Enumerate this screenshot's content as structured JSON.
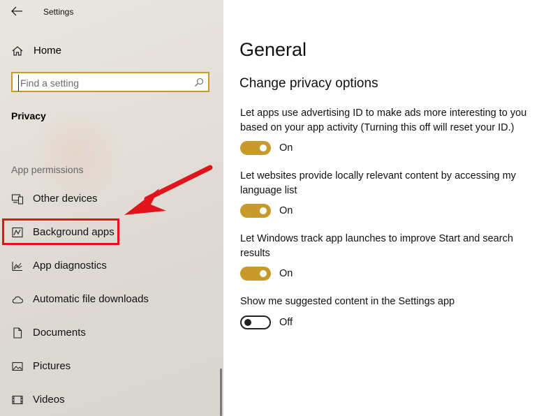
{
  "window": {
    "title": "Settings"
  },
  "sidebar": {
    "home_label": "Home",
    "search": {
      "placeholder": "Find a setting"
    },
    "section_title": "Privacy",
    "group_header": "App permissions",
    "items": [
      {
        "label": "Other devices",
        "icon": "devices-icon"
      },
      {
        "label": "Background apps",
        "icon": "background-apps-icon"
      },
      {
        "label": "App diagnostics",
        "icon": "app-diagnostics-icon"
      },
      {
        "label": "Automatic file downloads",
        "icon": "cloud-icon"
      },
      {
        "label": "Documents",
        "icon": "document-icon"
      },
      {
        "label": "Pictures",
        "icon": "picture-icon"
      },
      {
        "label": "Videos",
        "icon": "video-icon"
      }
    ]
  },
  "main": {
    "title": "General",
    "subtitle": "Change privacy options",
    "options": [
      {
        "text": "Let apps use advertising ID to make ads more interesting to you based on your app activity (Turning this off will reset your ID.)",
        "state": "On"
      },
      {
        "text": "Let websites provide locally relevant content by accessing my language list",
        "state": "On"
      },
      {
        "text": "Let Windows track app launches to improve Start and search results",
        "state": "On"
      },
      {
        "text": "Show me suggested content in the Settings app",
        "state": "Off"
      }
    ]
  },
  "colors": {
    "accent": "#c89a2c",
    "annotation": "#e0141a"
  }
}
